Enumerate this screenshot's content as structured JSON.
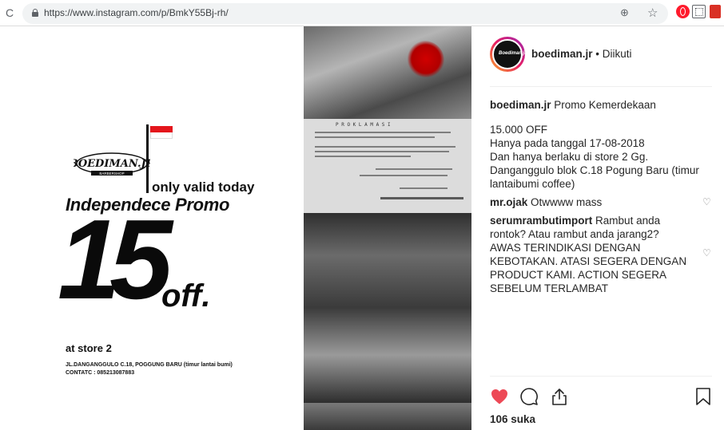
{
  "browser": {
    "url": "https://www.instagram.com/p/BmkY55Bj-rh/",
    "reload_glyph": "C",
    "zoom_glyph": "⊕",
    "star_glyph": "☆"
  },
  "post_image": {
    "logo_text": "BOEDIMAN.JR",
    "logo_sub": "BARBERSHOP",
    "only_valid": "only valid today",
    "promo_title": "Independece Promo",
    "big_number": "15",
    "off": "off.",
    "at_store": "at store 2",
    "address_line1": "JL.DANGANGGULO C.18, POGGUNG BARU (timur lantai bumi)",
    "address_line2": "CONTATC : 085213087883",
    "doc_title": "P R O K L A M A S I"
  },
  "header": {
    "avatar_text": "Boediman.jr",
    "username": "boediman.jr",
    "follow_state": "• Diikuti"
  },
  "caption": {
    "user": "boediman.jr",
    "title": "Promo Kemerdekaan",
    "body": "15.000 OFF\nHanya pada tanggal 17-08-2018\nDan hanya berlaku di store 2 Gg. Danganggulo blok C.18 Pogung Baru (timur lantaibumi coffee)"
  },
  "comments": [
    {
      "user": "mr.ojak",
      "text": "Otwwww mass"
    },
    {
      "user": "serumrambutimport",
      "text": "Rambut anda rontok? Atau rambut anda jarang2? AWAS TERINDIKASI DENGAN KEBOTAKAN. ATASI SEGERA DENGAN PRODUCT KAMI. ACTION SEGERA SEBELUM TERLAMBAT"
    }
  ],
  "likes": "106 suka",
  "colors": {
    "like_red": "#ed4956",
    "text": "#262626",
    "muted": "#8e8e8e"
  }
}
